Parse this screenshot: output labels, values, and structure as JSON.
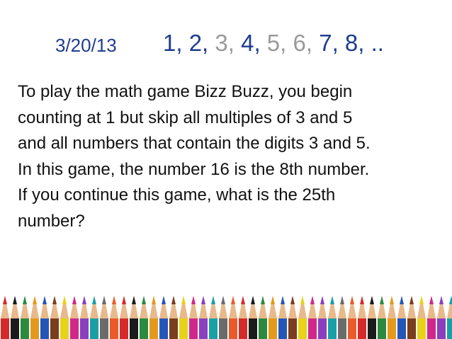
{
  "slide": {
    "date": "3/20/13",
    "sequence": [
      {
        "text": "1,",
        "style": "visible"
      },
      {
        "text": " 2,",
        "style": "visible"
      },
      {
        "text": " 3,",
        "style": "muted"
      },
      {
        "text": " 4,",
        "style": "visible"
      },
      {
        "text": " 5,",
        "style": "muted"
      },
      {
        "text": " 6,",
        "style": "muted"
      },
      {
        "text": " 7,",
        "style": "visible"
      },
      {
        "text": " 8,",
        "style": "visible"
      },
      {
        "text": " ..",
        "style": "visible"
      }
    ],
    "problem_lines": [
      "To play the math game Bizz Buzz, you begin",
      "counting at 1 but skip all multiples of 3 and 5",
      "and all numbers that contain the digits 3 and 5.",
      "In this game, the number 16 is the 8th number.",
      "If you continue this game, what is the 25th",
      "number?"
    ]
  },
  "colors": {
    "title_blue": "#1f3d8f",
    "muted_gray": "#9a9a9a",
    "text": "#111111",
    "pencil_wood": "#e8b98a",
    "pencil_leads": [
      "#d62a2a",
      "#1b1b1b",
      "#2b8a3e",
      "#e39a1c",
      "#2456b8",
      "#7a3e1e",
      "#e8d21a",
      "#d0288a",
      "#8a3fbf",
      "#19a0a6",
      "#6b6b6b",
      "#ea5b2a"
    ]
  },
  "decoration": {
    "pencil_border_icon": "colored-pencils-border"
  }
}
